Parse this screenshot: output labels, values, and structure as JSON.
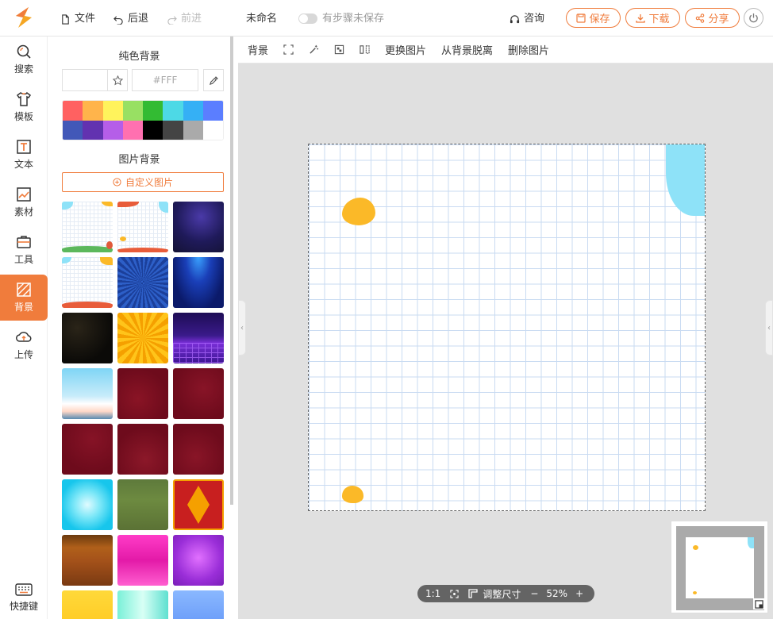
{
  "header": {
    "file": "文件",
    "undo": "后退",
    "redo": "前进",
    "doc_name": "未命名",
    "save_status": "有步骤未保存",
    "consult": "咨询",
    "save": "保存",
    "download": "下载",
    "share": "分享"
  },
  "sidebar": {
    "items": [
      {
        "label": "搜索",
        "icon": "search-icon"
      },
      {
        "label": "模板",
        "icon": "shirt-icon"
      },
      {
        "label": "文本",
        "icon": "text-icon"
      },
      {
        "label": "素材",
        "icon": "material-icon"
      },
      {
        "label": "工具",
        "icon": "toolbox-icon"
      },
      {
        "label": "背景",
        "icon": "background-icon",
        "active": true
      },
      {
        "label": "上传",
        "icon": "upload-icon"
      }
    ],
    "shortcut": "快捷键"
  },
  "panel": {
    "solid_title": "纯色背景",
    "hex_value": "#FFF",
    "palette": [
      "#ff6161",
      "#ffb44b",
      "#fff35c",
      "#98e063",
      "#33bb33",
      "#4dd9e6",
      "#35b0f5",
      "#5b7eff",
      "#4258b8",
      "#6232b0",
      "#b55ee8",
      "#ff70b0",
      "#000000",
      "#444444",
      "#aaaaaa",
      "#ffffff"
    ],
    "image_title": "图片背景",
    "custom_image": "自定义图片"
  },
  "edit_toolbar": {
    "background": "背景",
    "replace_image": "更换图片",
    "detach": "从背景脱离",
    "delete_image": "删除图片"
  },
  "zoom": {
    "ratio": "1:1",
    "adjust_size": "调整尺寸",
    "minus": "−",
    "value": "52%",
    "plus": "+"
  },
  "colors": {
    "accent": "#f07c3c",
    "blob_orange": "#fbb928",
    "blob_blue": "#7ee0f8"
  }
}
